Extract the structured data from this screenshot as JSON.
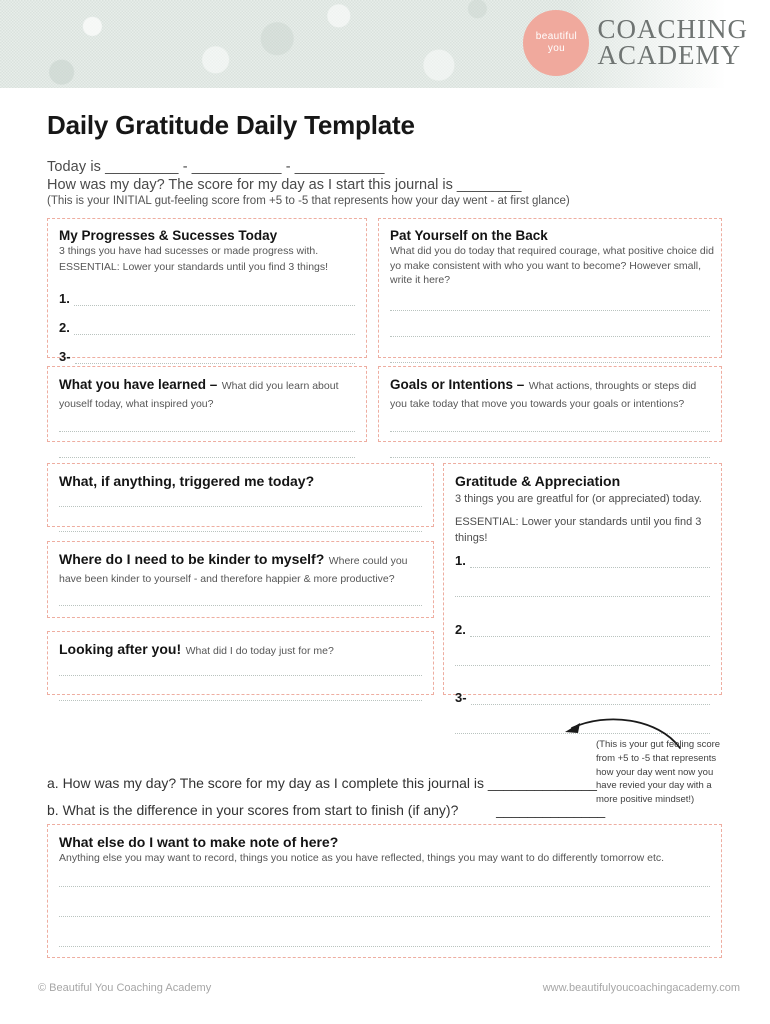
{
  "header": {
    "logo": {
      "badge_line1": "beautiful",
      "badge_line2": "you",
      "word1": "COACHING",
      "word2": "ACADEMY",
      "badge_color": "#f0a99d",
      "word_color": "#6f7472",
      "band_color": "#dfe7e2"
    }
  },
  "title": "Daily Gratitude Daily Template",
  "intro": {
    "line1": "Today is _________ - ___________ - ___________",
    "line2": "How was my day? The score for my day as I start this journal is ________",
    "line3": "(This is your INITIAL gut-feeling score from +5 to -5 that represents how your day went - at first glance)"
  },
  "boxes": {
    "progresses": {
      "heading": "My Progresses & Sucesses Today",
      "sub1": "3 things you have had sucesses or made progress with.",
      "sub2": "ESSENTIAL: Lower your standards until you find 3 things!",
      "items": [
        "1.",
        "2.",
        "3-"
      ]
    },
    "pat_on_back": {
      "heading": "Pat Yourself on the Back",
      "sub": "What did you do today that required courage, what positive choice did yo make consistent with who you want to become? However small, write it here?"
    },
    "learned": {
      "heading": "What you have learned –",
      "sub": "What did you learn about youself today, what inspired you?"
    },
    "goals": {
      "heading": "Goals or Intentions –",
      "sub": "What actions, throughts or steps did you take today that move you towards your goals or intentions?"
    },
    "triggered": {
      "heading": "What, if anything, triggered me today?"
    },
    "kinder": {
      "heading": "Where do I need to be kinder to myself?",
      "sub": "Where could you have been kinder to yourself - and therefore happier & more productive?"
    },
    "looking_after": {
      "heading": "Looking after you!",
      "sub": "What did I do today just for me?"
    },
    "gratitude": {
      "heading": "Gratitude & Appreciation",
      "sub1": "3 things you are greatful for (or appreciated) today.",
      "sub2": "ESSENTIAL: Lower your standards until you find 3 things!",
      "items": [
        "1.",
        "2.",
        "3-"
      ]
    },
    "what_else": {
      "heading": "What else do I want to make note of here?",
      "sub": "Anything else you may want to record, things you notice as you have reflected, things you may want to do differently tomorrow etc."
    }
  },
  "callout": {
    "line1": "(This is your gut feeling score",
    "line2": "from +5 to -5 that represents",
    "line3": "how your day went now you",
    "line4": "have revied your day with a",
    "line5": "more positive mindset!)"
  },
  "questions": {
    "a": "a. How was my day? The score for my day as I complete this journal is ______________",
    "b": "b. What is the difference in your scores from start to finish (if any)?",
    "b_blank": "______________"
  },
  "footer": {
    "copyright": "©  Beautiful You Coaching Academy",
    "website": "www.beautifulyoucoachingacademy.com"
  }
}
